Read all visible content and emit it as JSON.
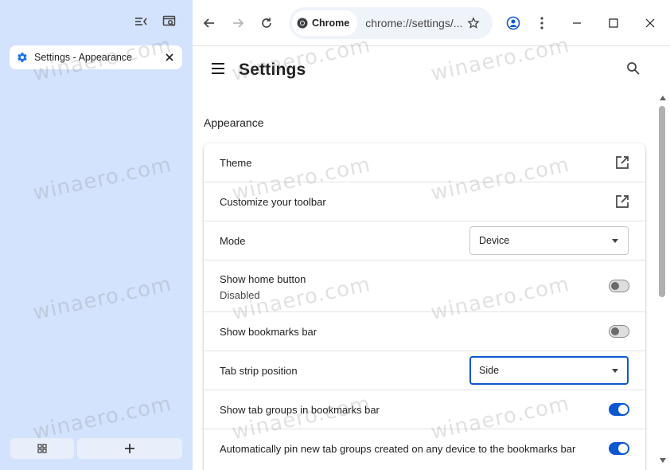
{
  "tab": {
    "title": "Settings - Appearance"
  },
  "omnibox": {
    "chip_label": "Chrome",
    "url": "chrome://settings/..."
  },
  "settings": {
    "title": "Settings"
  },
  "section": {
    "title": "Appearance"
  },
  "rows": {
    "theme": {
      "label": "Theme"
    },
    "toolbar": {
      "label": "Customize your toolbar"
    },
    "mode": {
      "label": "Mode",
      "value": "Device"
    },
    "home": {
      "label": "Show home button",
      "sub": "Disabled",
      "enabled": false
    },
    "bookmarks": {
      "label": "Show bookmarks bar",
      "enabled": false
    },
    "tabstrip": {
      "label": "Tab strip position",
      "value": "Side"
    },
    "tabgroups": {
      "label": "Show tab groups in bookmarks bar",
      "enabled": true
    },
    "autopin": {
      "label": "Automatically pin new tab groups created on any device to the bookmarks bar",
      "enabled": true
    }
  },
  "watermark": "winaero.com",
  "colors": {
    "accent": "#0b57d0",
    "sidebar": "#d3e3fd",
    "omnibox": "#eff3fa"
  }
}
